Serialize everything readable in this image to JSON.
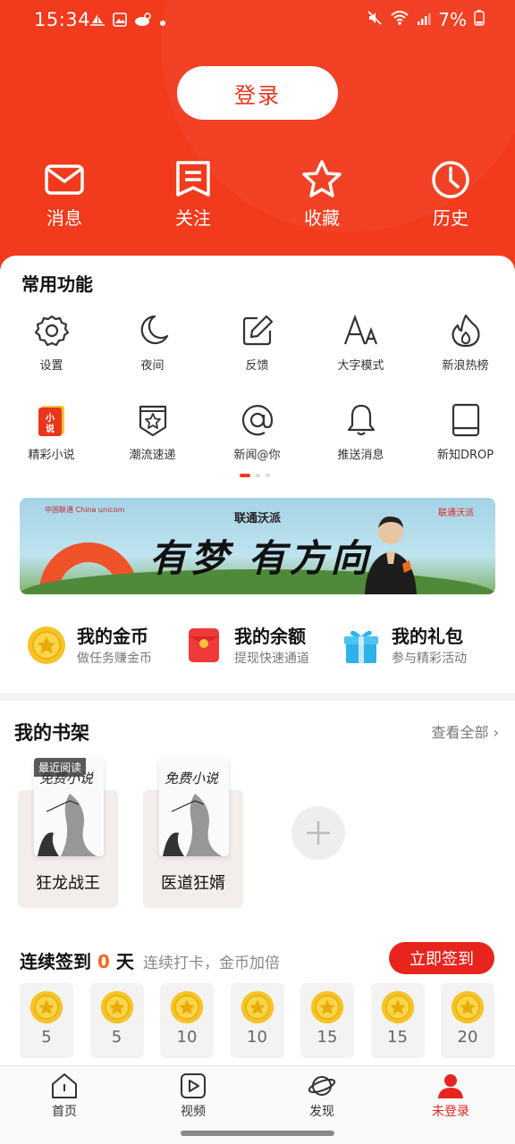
{
  "status_bar": {
    "time": "15:34",
    "battery": "7%"
  },
  "header": {
    "login_label": "登录",
    "actions": [
      {
        "label": "消息",
        "icon": "mail-icon"
      },
      {
        "label": "关注",
        "icon": "bookmark-list-icon"
      },
      {
        "label": "收藏",
        "icon": "star-icon"
      },
      {
        "label": "历史",
        "icon": "clock-icon"
      }
    ]
  },
  "functions": {
    "title": "常用功能",
    "items": [
      {
        "label": "设置",
        "icon": "gear-icon"
      },
      {
        "label": "夜间",
        "icon": "moon-icon"
      },
      {
        "label": "反馈",
        "icon": "edit-icon"
      },
      {
        "label": "大字模式",
        "icon": "font-size-icon"
      },
      {
        "label": "新浪热榜",
        "icon": "flame-icon"
      },
      {
        "label": "精彩小说",
        "icon": "novel-book-icon"
      },
      {
        "label": "潮流速递",
        "icon": "star-badge-icon"
      },
      {
        "label": "新闻@你",
        "icon": "at-icon"
      },
      {
        "label": "推送消息",
        "icon": "bell-icon"
      },
      {
        "label": "新知DROP",
        "icon": "tablet-icon"
      }
    ],
    "page_indicator": {
      "pages": 3,
      "active": 1
    }
  },
  "banner": {
    "logo_left": "中国联通 China unicom",
    "logo_right": "联通沃派",
    "subtitle": "联通沃派",
    "title": "有梦 有方向"
  },
  "wallet": [
    {
      "title": "我的金币",
      "subtitle": "做任务赚金币",
      "icon": "gold-coin-icon"
    },
    {
      "title": "我的余额",
      "subtitle": "提现快速通道",
      "icon": "red-envelope-icon"
    },
    {
      "title": "我的礼包",
      "subtitle": "参与精彩活动",
      "icon": "gift-icon"
    }
  ],
  "bookshelf": {
    "title": "我的书架",
    "more_label": "查看全部",
    "books": [
      {
        "name": "狂龙战王",
        "badge": "最近阅读",
        "cover_text": "免费小说"
      },
      {
        "name": "医道狂婿",
        "badge": "",
        "cover_text": "免费小说"
      }
    ]
  },
  "signin": {
    "prefix": "连续签到",
    "days": "0",
    "unit": "天",
    "note": "连续打卡，金币加倍",
    "button": "立即签到",
    "rewards": [
      "5",
      "5",
      "10",
      "10",
      "15",
      "15",
      "20"
    ]
  },
  "bottom_nav": [
    {
      "label": "首页",
      "icon": "home-icon",
      "active": false
    },
    {
      "label": "视频",
      "icon": "play-icon",
      "active": false
    },
    {
      "label": "发现",
      "icon": "planet-icon",
      "active": false
    },
    {
      "label": "未登录",
      "icon": "user-icon",
      "active": true
    }
  ],
  "colors": {
    "brand_red": "#f23a1c",
    "accent_orange": "#f26a1c"
  }
}
